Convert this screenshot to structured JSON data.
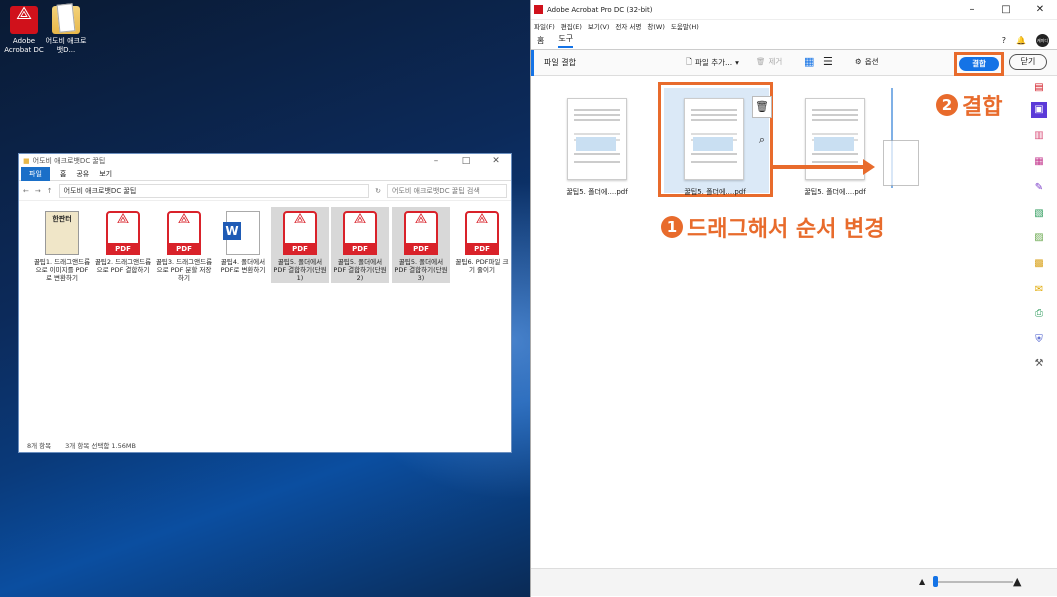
{
  "desktop": {
    "icons": [
      {
        "label": "Adobe Acrobat DC"
      },
      {
        "label": "어도비 애크로뱃D..."
      }
    ]
  },
  "explorer": {
    "title": "어도비 애크로뱃DC 꿀팁",
    "ribbon": [
      "파일",
      "홈",
      "공유",
      "보기"
    ],
    "path": "어도비 애크로뱃DC 꿀팁",
    "search_placeholder": "어도비 애크로뱃DC 꿀팁 검색",
    "files": [
      {
        "name": "꿀팁1. 드래그앤드롭으로 이미지를 PDF로 변환하기",
        "type": "book"
      },
      {
        "name": "꿀팁2. 드래그앤드롭으로 PDF 결합하기",
        "type": "pdf"
      },
      {
        "name": "꿀팁3. 드래그앤드롭으로 PDF 분할 저장하기",
        "type": "pdf"
      },
      {
        "name": "꿀팁4. 폴더에서 PDF로 변환하기",
        "type": "word"
      },
      {
        "name": "꿀팁5. 폴더에서 PDF 결합하기(단원1)",
        "type": "pdf",
        "selected": true
      },
      {
        "name": "꿀팁5. 폴더에서 PDF 결합하기(단원2)",
        "type": "pdf",
        "selected": true
      },
      {
        "name": "꿀팁5. 폴더에서 PDF 결합하기(단원3)",
        "type": "pdf",
        "selected": true
      },
      {
        "name": "꿀팁6. PDF파일 크기 줄이기",
        "type": "pdf"
      }
    ],
    "status_count": "8개 항목",
    "status_selected": "3개 항목 선택함 1.56MB"
  },
  "acrobat": {
    "title": "Adobe Acrobat Pro DC (32-bit)",
    "menu": [
      "파일(F)",
      "편집(E)",
      "보기(V)",
      "전자 서명",
      "창(W)",
      "도움말(H)"
    ],
    "tabs": [
      "홈",
      "도구"
    ],
    "avatar": "캐미디",
    "toolbar_name": "파일 결합",
    "add_files": "파일 추가...",
    "remove": "제거",
    "options": "옵션",
    "combine": "결합",
    "close": "닫기",
    "thumbs": [
      "꿀팁5. 폴더에....pdf",
      "꿀팁5. 폴더에....pdf",
      "꿀팁5. 폴더에....pdf"
    ],
    "annotation1": "드래그해서 순서 변경",
    "annotation2": "결합",
    "num1": "1",
    "num2": "2",
    "accent": "#1473e6",
    "highlight": "#e86b2c"
  }
}
